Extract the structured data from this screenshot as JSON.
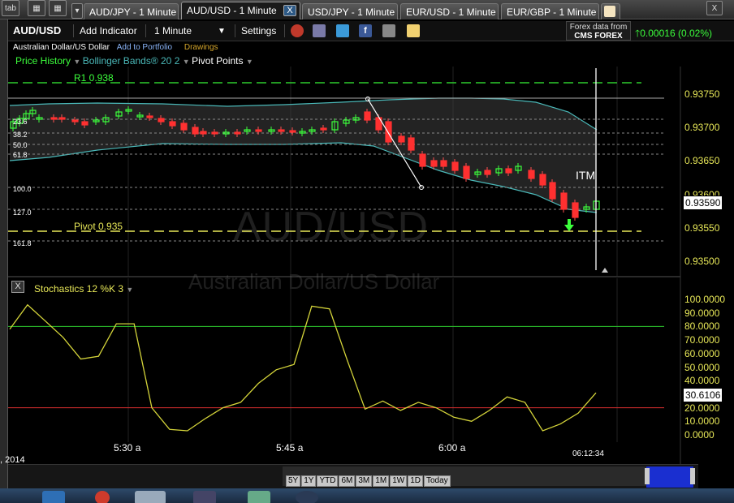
{
  "tabbar": {
    "tab_button": "tab",
    "tabs": [
      {
        "label": "AUD/JPY - 1 Minute"
      },
      {
        "label": "AUD/USD - 1 Minute"
      },
      {
        "label": "USD/JPY - 1 Minute"
      },
      {
        "label": "EUR/USD - 1 Minute"
      },
      {
        "label": "EUR/GBP - 1 Minute"
      }
    ],
    "close_label": "X",
    "window_close_label": "X"
  },
  "toolbar": {
    "symbol": "AUD/USD",
    "add_indicator": "Add Indicator",
    "interval": "1 Minute",
    "settings": "Settings",
    "data_from": "Forex data from",
    "provider": "CMS FOREX",
    "change": "0.00016 (0.02%)",
    "colors": {
      "up": "#3cff3c",
      "accent": "#2e5a86"
    }
  },
  "subline": {
    "name": "Australian Dollar/US Dollar",
    "add_portfolio": "Add to Portfolio",
    "drawings": "Drawings"
  },
  "indicators": {
    "price_history": "Price History",
    "bollinger": "Bollinger Bands® 20 2",
    "pivot": "Pivot Points"
  },
  "chart": {
    "watermark_symbol": "AUD/USD",
    "watermark_name": "Australian Dollar/US Dollar",
    "r1_label": "R1 0.938",
    "pivot_label": "Pivot 0.935",
    "itm_label": "ITM",
    "current_price": "0.93590",
    "fib_levels": [
      "23.6",
      "38.2",
      "50.0",
      "61.8",
      "100.0",
      "127.0",
      "161.8"
    ],
    "price_axis": [
      "0.93750",
      "0.93700",
      "0.93650",
      "0.93600",
      "0.93550",
      "0.93500"
    ],
    "stoch_label": "Stochastics 12 %K 3",
    "stoch_axis": [
      "100.0000",
      "90.0000",
      "80.0000",
      "70.0000",
      "60.0000",
      "50.0000",
      "40.0000",
      "30.0000",
      "20.0000",
      "10.0000",
      "0.0000"
    ],
    "stoch_value": "30.6106",
    "time_axis": [
      "5:30 a",
      "5:45 a",
      "6:00 a"
    ],
    "date": ", 2014",
    "crosshair_time": "06:12:34",
    "range_buttons": [
      "5Y",
      "1Y",
      "YTD",
      "6M",
      "3M",
      "1M",
      "1W",
      "1D",
      "Today"
    ]
  },
  "chart_data": [
    {
      "type": "line",
      "title": "Stochastics 12 %K 3",
      "ylim": [
        0,
        100
      ],
      "x_ticks": [
        "5:30 a",
        "5:45 a",
        "6:00 a"
      ],
      "series": [
        {
          "name": "%K",
          "values": [
            78,
            96,
            84,
            72,
            56,
            58,
            82,
            82,
            20,
            4,
            3,
            12,
            20,
            24,
            38,
            48,
            52,
            95,
            93,
            55,
            19,
            25,
            18,
            24,
            20,
            13,
            10,
            18,
            28,
            24,
            3,
            8,
            16,
            31
          ]
        }
      ],
      "reference_lines": [
        80,
        20
      ]
    }
  ]
}
